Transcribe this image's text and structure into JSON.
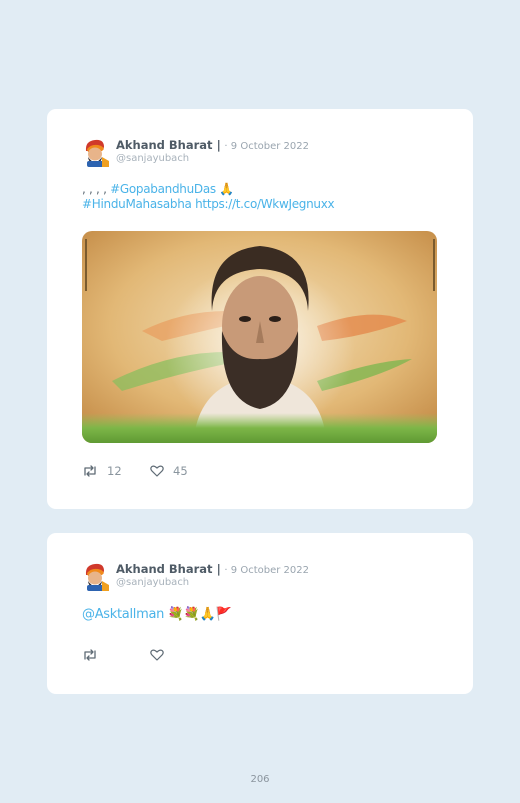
{
  "tweets": [
    {
      "author": "Akhand Bharat |",
      "date": "· 9 October 2022",
      "handle": "@sanjayubach",
      "text_prefix": ", , , , ",
      "hashtag1": "#GopabandhuDas",
      "emoji1": "🙏",
      "hashtag2": "#HinduMahasabha",
      "link": "https://t.co/WkwJegnuxx",
      "retweets": "12",
      "likes": "45",
      "icons": [
        "avatar",
        "retweet-icon",
        "heart-icon"
      ],
      "media": "portrait-illustration"
    },
    {
      "author": "Akhand Bharat |",
      "date": "· 9 October 2022",
      "handle": "@sanjayubach",
      "mention": "@Asktallman",
      "emojis": "💐💐🙏🚩",
      "retweets": "",
      "likes": "",
      "icons": [
        "avatar",
        "retweet-icon",
        "heart-icon"
      ]
    }
  ],
  "page_number": "206",
  "colors": {
    "background": "#e1ecf4",
    "card": "#ffffff",
    "link": "#4ab3e8",
    "name": "#4f5b66",
    "muted": "#9aa5af"
  }
}
